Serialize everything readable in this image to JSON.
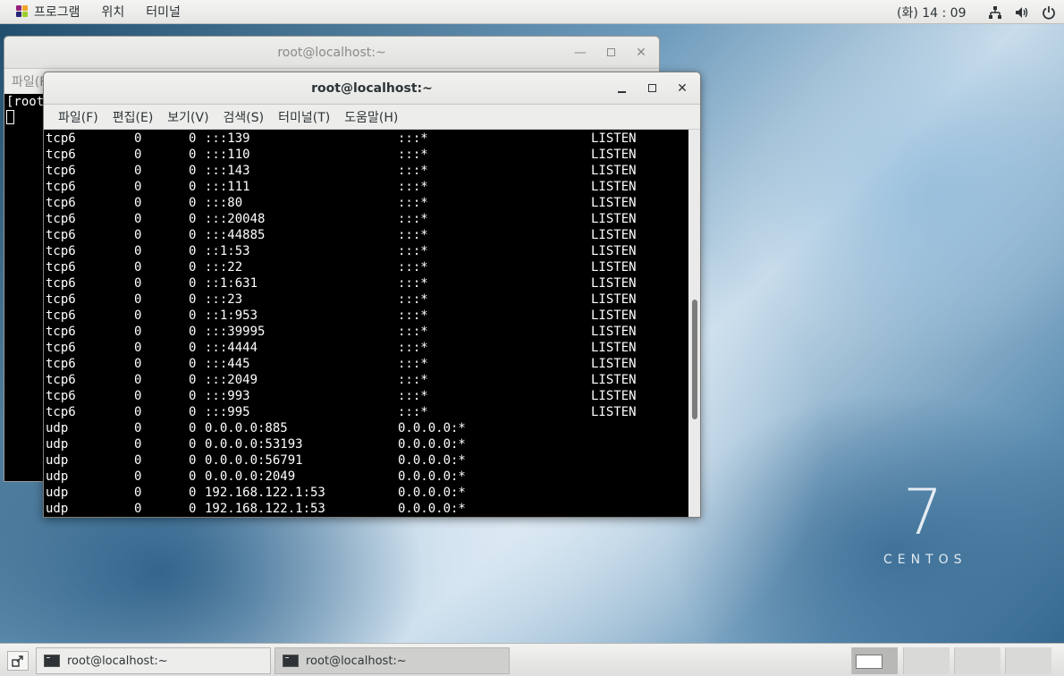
{
  "topbar": {
    "menu": [
      "프로그램",
      "위치",
      "터미널"
    ],
    "clock": "(화) 14 : 09"
  },
  "back_window": {
    "title": "root@localhost:~",
    "menu_partial": "파일(F",
    "terminal_partial": "[root"
  },
  "front_window": {
    "title": "root@localhost:~",
    "menu": [
      "파일(F)",
      "편집(E)",
      "보기(V)",
      "검색(S)",
      "터미널(T)",
      "도움말(H)"
    ]
  },
  "terminal_rows": [
    {
      "proto": "tcp6",
      "recv": "0",
      "send": "0",
      "local": ":::139",
      "foreign": ":::*",
      "state": "LISTEN"
    },
    {
      "proto": "tcp6",
      "recv": "0",
      "send": "0",
      "local": ":::110",
      "foreign": ":::*",
      "state": "LISTEN"
    },
    {
      "proto": "tcp6",
      "recv": "0",
      "send": "0",
      "local": ":::143",
      "foreign": ":::*",
      "state": "LISTEN"
    },
    {
      "proto": "tcp6",
      "recv": "0",
      "send": "0",
      "local": ":::111",
      "foreign": ":::*",
      "state": "LISTEN"
    },
    {
      "proto": "tcp6",
      "recv": "0",
      "send": "0",
      "local": ":::80",
      "foreign": ":::*",
      "state": "LISTEN"
    },
    {
      "proto": "tcp6",
      "recv": "0",
      "send": "0",
      "local": ":::20048",
      "foreign": ":::*",
      "state": "LISTEN"
    },
    {
      "proto": "tcp6",
      "recv": "0",
      "send": "0",
      "local": ":::44885",
      "foreign": ":::*",
      "state": "LISTEN"
    },
    {
      "proto": "tcp6",
      "recv": "0",
      "send": "0",
      "local": "::1:53",
      "foreign": ":::*",
      "state": "LISTEN"
    },
    {
      "proto": "tcp6",
      "recv": "0",
      "send": "0",
      "local": ":::22",
      "foreign": ":::*",
      "state": "LISTEN"
    },
    {
      "proto": "tcp6",
      "recv": "0",
      "send": "0",
      "local": "::1:631",
      "foreign": ":::*",
      "state": "LISTEN"
    },
    {
      "proto": "tcp6",
      "recv": "0",
      "send": "0",
      "local": ":::23",
      "foreign": ":::*",
      "state": "LISTEN"
    },
    {
      "proto": "tcp6",
      "recv": "0",
      "send": "0",
      "local": "::1:953",
      "foreign": ":::*",
      "state": "LISTEN"
    },
    {
      "proto": "tcp6",
      "recv": "0",
      "send": "0",
      "local": ":::39995",
      "foreign": ":::*",
      "state": "LISTEN"
    },
    {
      "proto": "tcp6",
      "recv": "0",
      "send": "0",
      "local": ":::4444",
      "foreign": ":::*",
      "state": "LISTEN"
    },
    {
      "proto": "tcp6",
      "recv": "0",
      "send": "0",
      "local": ":::445",
      "foreign": ":::*",
      "state": "LISTEN"
    },
    {
      "proto": "tcp6",
      "recv": "0",
      "send": "0",
      "local": ":::2049",
      "foreign": ":::*",
      "state": "LISTEN"
    },
    {
      "proto": "tcp6",
      "recv": "0",
      "send": "0",
      "local": ":::993",
      "foreign": ":::*",
      "state": "LISTEN"
    },
    {
      "proto": "tcp6",
      "recv": "0",
      "send": "0",
      "local": ":::995",
      "foreign": ":::*",
      "state": "LISTEN"
    },
    {
      "proto": "udp",
      "recv": "0",
      "send": "0",
      "local": "0.0.0.0:885",
      "foreign": "0.0.0.0:*",
      "state": ""
    },
    {
      "proto": "udp",
      "recv": "0",
      "send": "0",
      "local": "0.0.0.0:53193",
      "foreign": "0.0.0.0:*",
      "state": ""
    },
    {
      "proto": "udp",
      "recv": "0",
      "send": "0",
      "local": "0.0.0.0:56791",
      "foreign": "0.0.0.0:*",
      "state": ""
    },
    {
      "proto": "udp",
      "recv": "0",
      "send": "0",
      "local": "0.0.0.0:2049",
      "foreign": "0.0.0.0:*",
      "state": ""
    },
    {
      "proto": "udp",
      "recv": "0",
      "send": "0",
      "local": "192.168.122.1:53",
      "foreign": "0.0.0.0:*",
      "state": ""
    },
    {
      "proto": "udp",
      "recv": "0",
      "send": "0",
      "local": "192.168.122.1:53",
      "foreign": "0.0.0.0:*",
      "state": ""
    }
  ],
  "desktop": {
    "logo_number": "7",
    "logo_word": "CENTOS"
  },
  "taskbar": {
    "tasks": [
      {
        "label": "root@localhost:~"
      },
      {
        "label": "root@localhost:~"
      }
    ]
  }
}
